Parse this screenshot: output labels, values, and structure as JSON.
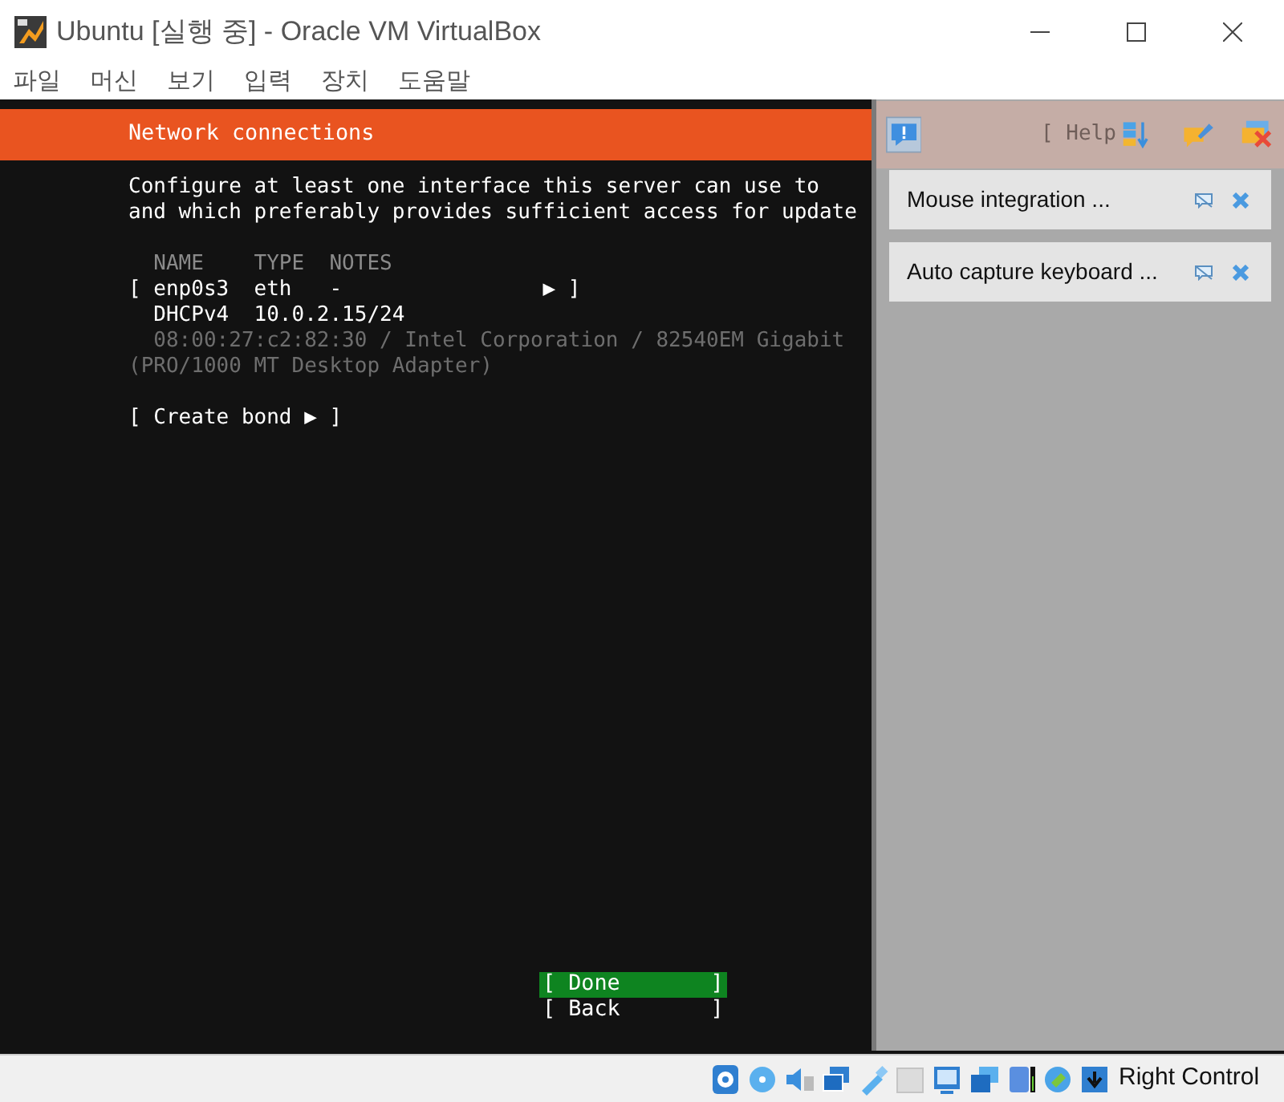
{
  "window": {
    "title": "Ubuntu [실행 중] - Oracle VM VirtualBox"
  },
  "menu": [
    "파일",
    "머신",
    "보기",
    "입력",
    "장치",
    "도움말"
  ],
  "installer": {
    "header": "Network connections",
    "intro": [
      "Configure at least one interface this server can use to",
      "and which preferably provides sufficient access for update"
    ],
    "columns": "  NAME    TYPE  NOTES",
    "interfaces": [
      {
        "row": "[ enp0s3  eth   -                ▶ ]",
        "address": "  DHCPv4  10.0.2.15/24",
        "details": [
          "  08:00:27:c2:82:30 / Intel Corporation / 82540EM Gigabit",
          "(PRO/1000 MT Desktop Adapter)"
        ]
      }
    ],
    "create_bond": "[ Create bond ▶ ]",
    "buttons": [
      {
        "label": "[ Done       ]",
        "selected": true
      },
      {
        "label": "[ Back       ]",
        "selected": false
      }
    ]
  },
  "overlay": {
    "help": "[ Help",
    "notifications": [
      "Mouse integration ...",
      "Auto capture keyboard ..."
    ]
  },
  "status_bar": {
    "host_key": "Right Control"
  }
}
